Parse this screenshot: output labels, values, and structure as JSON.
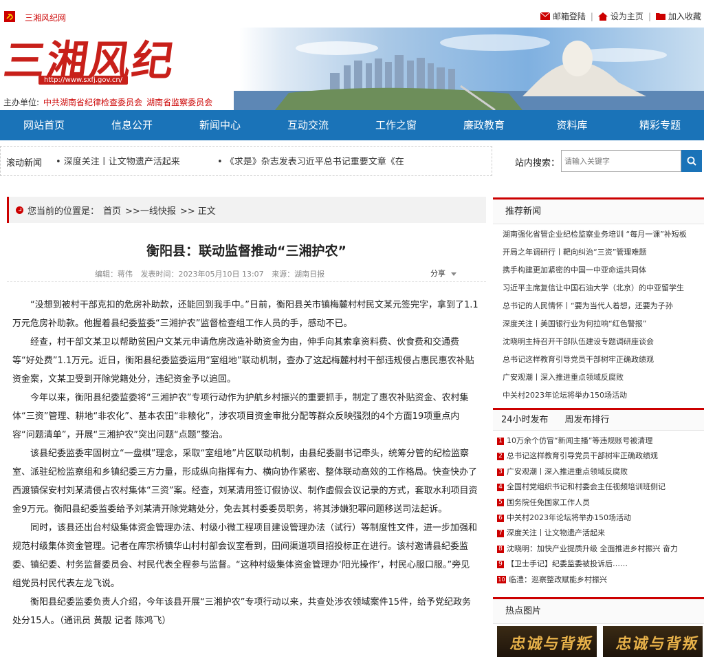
{
  "topbar": {
    "site_name": "三湘风纪网",
    "links": [
      "邮箱登陆",
      "设为主页",
      "加入收藏"
    ]
  },
  "banner": {
    "logo_url": "http://www.sxfj.gov.cn/",
    "host_label": "主办单位:",
    "host_orgs": [
      "中共湖南省纪律检查委员会",
      "湖南省监察委员会"
    ]
  },
  "nav": [
    "网站首页",
    "信息公开",
    "新闻中心",
    "互动交流",
    "工作之窗",
    "廉政教育",
    "资料库",
    "精彩专题"
  ],
  "scroll_news": {
    "label": "滚动新闻",
    "items": [
      "• 深度关注丨让文物遗产活起来",
      "• 《求是》杂志发表习近平总书记重要文章《在"
    ]
  },
  "search": {
    "label": "站内搜索：",
    "placeholder": "请输入关键字"
  },
  "breadcrumb": {
    "prefix": "您当前的位置是：",
    "items": [
      "首页",
      ">>一线快报",
      ">> 正文"
    ]
  },
  "article": {
    "title": "衡阳县：联动监督推动“三湘护农”",
    "editor": "编辑：蒋伟",
    "time": "发表时间：2023年05月10日 13:07",
    "source": "来源：湖南日报",
    "share": "分享",
    "paragraphs": [
      "“没想到被村干部克扣的危房补助款，还能回到我手中。”日前，衡阳县关市镇梅麓村村民文某元签完字，拿到了1.1万元危房补助款。他握着县纪委监委“三湘护农”监督检查组工作人员的手，感动不已。",
      "经查，村干部文某卫以帮助贫困户文某元申请危房改造补助资金为由，伸手向其索拿资料费、伙食费和交通费等“好处费”1.1万元。近日，衡阳县纪委监委运用“室组地”联动机制，查办了这起梅麓村村干部违规侵占惠民惠农补贴资金案，文某卫受到开除党籍处分，违纪资金予以追回。",
      "今年以来，衡阳县纪委监委将“三湘护农”专项行动作为护航乡村振兴的重要抓手，制定了惠农补贴资金、农村集体“三资”管理、耕地“非农化”、基本农田“非粮化”，涉农项目资金审批分配等群众反映强烈的4个方面19项重点内容“问题清单”，开展“三湘护农”突出问题“点题”整治。",
      "该县纪委监委牢固树立“一盘棋”理念，采取“室组地”片区联动机制，由县纪委副书记牵头，统筹分管的纪检监察室、派驻纪检监察组和乡镇纪委三方力量，形成纵向指挥有力、横向协作紧密、整体联动高效的工作格局。快查快办了西渡镇保安村刘某清侵占农村集体“三资”案。经查，刘某清用签订假协议、制作虚假会议记录的方式，套取水利项目资金9万元。衡阳县纪委监委给予刘某清开除党籍处分，免去其村委委员职务，将其涉嫌犯罪问题移送司法起诉。",
      "同时，该县还出台村级集体资金管理办法、村级小微工程项目建设管理办法（试行）等制度性文件，进一步加强和规范村级集体资金管理。记者在库宗桥镇华山村村部会议室看到，田间渠道项目招投标正在进行。该村邀请县纪委监委、镇纪委、村务监督委员会、村民代表全程参与监督。“这种村级集体资金管理办‘阳光操作’，村民心服口服。”旁见组党员村民代表左龙飞说。",
      "衡阳县纪委监委负责人介绍，今年该县开展“三湘护农”专项行动以来，共查处涉农领域案件15件，给予党纪政务处分15人。（通讯员 黄靓 记者 陈鸿飞）"
    ]
  },
  "recommended": {
    "title": "推荐新闻",
    "items": [
      "湖南强化省管企业纪检监察业务培训 “每月一课”补短板",
      "开局之年调研行丨靶向纠治“三资”管理难题",
      "携手构建更加紧密的中国一中亚命运共同体",
      "习近平主席复信让中国石油大学（北京）的中亚留学生",
      "总书记的人民情怀丨“要为当代人着想，还要为子孙",
      "深度关注丨美国银行业为何拉响“红色警报”",
      "沈晓明主持召开干部队伍建设专题调研座谈会",
      "总书记这样教育引导党员干部树牢正确政绩观",
      "广安观潮丨深入推进重点领域反腐败",
      "中关村2023年论坛将举办150场活动"
    ]
  },
  "hot": {
    "tabs": [
      "24小时发布",
      "周发布排行"
    ],
    "items": [
      "10万余个仿冒“新闻主播”等违规账号被清理",
      "总书记这样教育引导党员干部树牢正确政绩观",
      "广安观潮丨深入推进重点领域反腐败",
      "全国村党组织书记和村委会主任视频培训班侧记",
      "国务院任免国家工作人员",
      "中关村2023年论坛将举办150场活动",
      "深度关注丨让文物遗产活起来",
      "沈晓明：加快产业提质升级 全面推进乡村振兴 奋力",
      "【卫士手记】纪委监委被投诉后……",
      "临澧：巡察整改赋能乡村振兴"
    ]
  },
  "pictures": {
    "title": "热点图片"
  },
  "colors": {
    "brand_red": "#c8201a",
    "nav_blue": "#1a73b8"
  }
}
